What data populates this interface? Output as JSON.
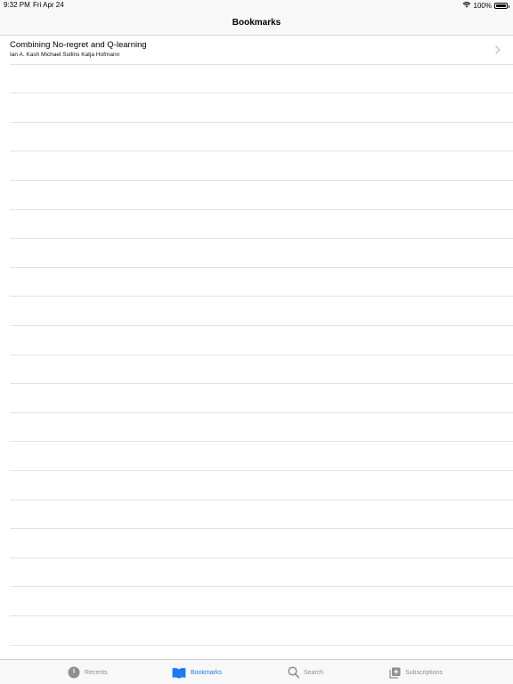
{
  "status_bar": {
    "time": "9:32 PM",
    "date": "Fri Apr 24",
    "battery": "100%",
    "battery_level": 1.0,
    "wifi_icon": "wifi-icon"
  },
  "nav": {
    "title": "Bookmarks"
  },
  "list": {
    "items": [
      {
        "title": "Combining No-regret and Q-learning",
        "subtitle": "Ian A. Kash Michael Sullins Katja Hofmann",
        "accessory": "chevron-right-icon"
      }
    ],
    "empty_row_count": 20
  },
  "tab_bar": {
    "tabs": [
      {
        "label": "Recents",
        "icon": "clock-icon",
        "active": false
      },
      {
        "label": "Bookmarks",
        "icon": "book-icon",
        "active": true
      },
      {
        "label": "Search",
        "icon": "magnifier-icon",
        "active": false
      },
      {
        "label": "Subscriptions",
        "icon": "subscriptions-icon",
        "active": false
      }
    ],
    "active_color": "#1a7cf2",
    "inactive_color": "#8e8e93"
  }
}
